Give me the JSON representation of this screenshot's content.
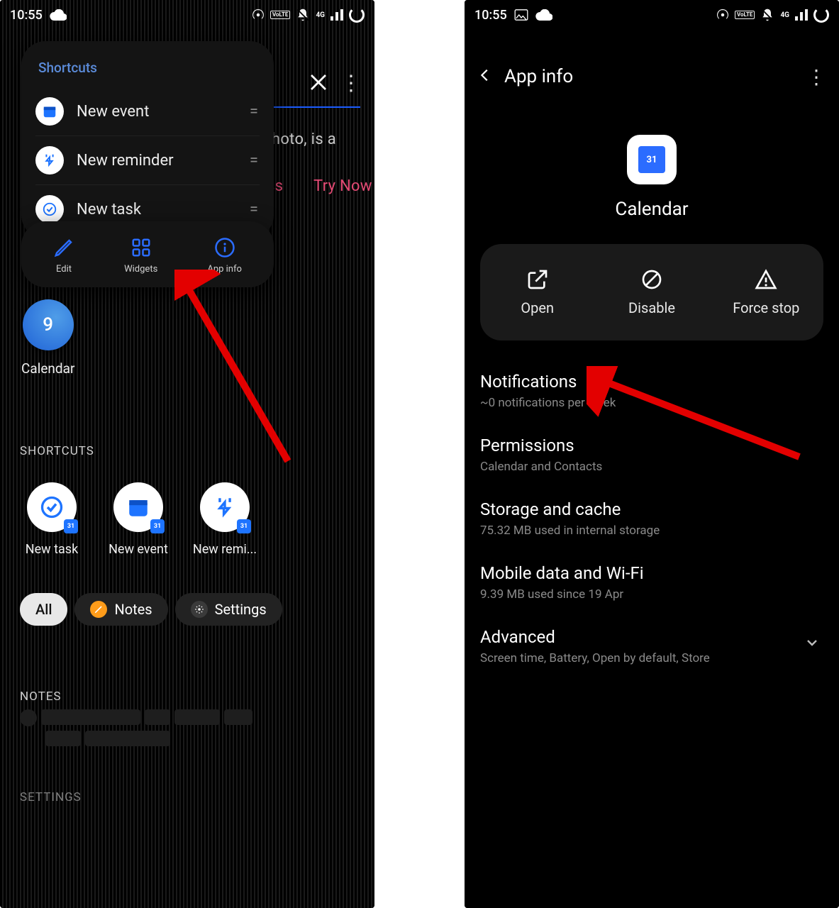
{
  "status": {
    "time": "10:55",
    "volte": "VoLTE",
    "signal_label": "4G"
  },
  "left": {
    "close_icon": "×",
    "bg_snippet_1": "›hoto, is a",
    "bg_snippet_2": "ss",
    "bg_try_now": "Try Now",
    "popup_title": "Shortcuts",
    "shortcut_items": [
      {
        "label": "New event",
        "icon": "calendar-icon"
      },
      {
        "label": "New reminder",
        "icon": "reminder-icon"
      },
      {
        "label": "New task",
        "icon": "task-icon"
      }
    ],
    "actions": [
      {
        "label": "Edit",
        "name": "edit-action"
      },
      {
        "label": "Widgets",
        "name": "widgets-action"
      },
      {
        "label": "App info",
        "name": "appinfo-action"
      }
    ],
    "calendar_day": "9",
    "calendar_label": "Calendar",
    "section_shortcuts": "SHORTCUTS",
    "home_shortcuts": [
      {
        "label": "New task",
        "badge": "31"
      },
      {
        "label": "New event",
        "badge": "31"
      },
      {
        "label": "New remi...",
        "badge": "31"
      }
    ],
    "pills": [
      {
        "label": "All",
        "active": true
      },
      {
        "label": "Notes",
        "icon": "notes"
      },
      {
        "label": "Settings",
        "icon": "settings"
      }
    ],
    "section_notes": "NOTES",
    "section_settings": "SETTINGS"
  },
  "right": {
    "header": "App info",
    "app_name": "Calendar",
    "app_icon_day": "31",
    "buttons": [
      {
        "label": "Open",
        "name": "open-button"
      },
      {
        "label": "Disable",
        "name": "disable-button"
      },
      {
        "label": "Force stop",
        "name": "force-stop-button"
      }
    ],
    "settings": [
      {
        "title": "Notifications",
        "sub": "~0 notifications per week"
      },
      {
        "title": "Permissions",
        "sub": "Calendar and Contacts"
      },
      {
        "title": "Storage and cache",
        "sub": "75.32 MB used in internal storage"
      },
      {
        "title": "Mobile data and Wi-Fi",
        "sub": "9.39 MB used since 19 Apr"
      },
      {
        "title": "Advanced",
        "sub": "Screen time, Battery, Open by default, Store",
        "chevron": true
      }
    ]
  }
}
